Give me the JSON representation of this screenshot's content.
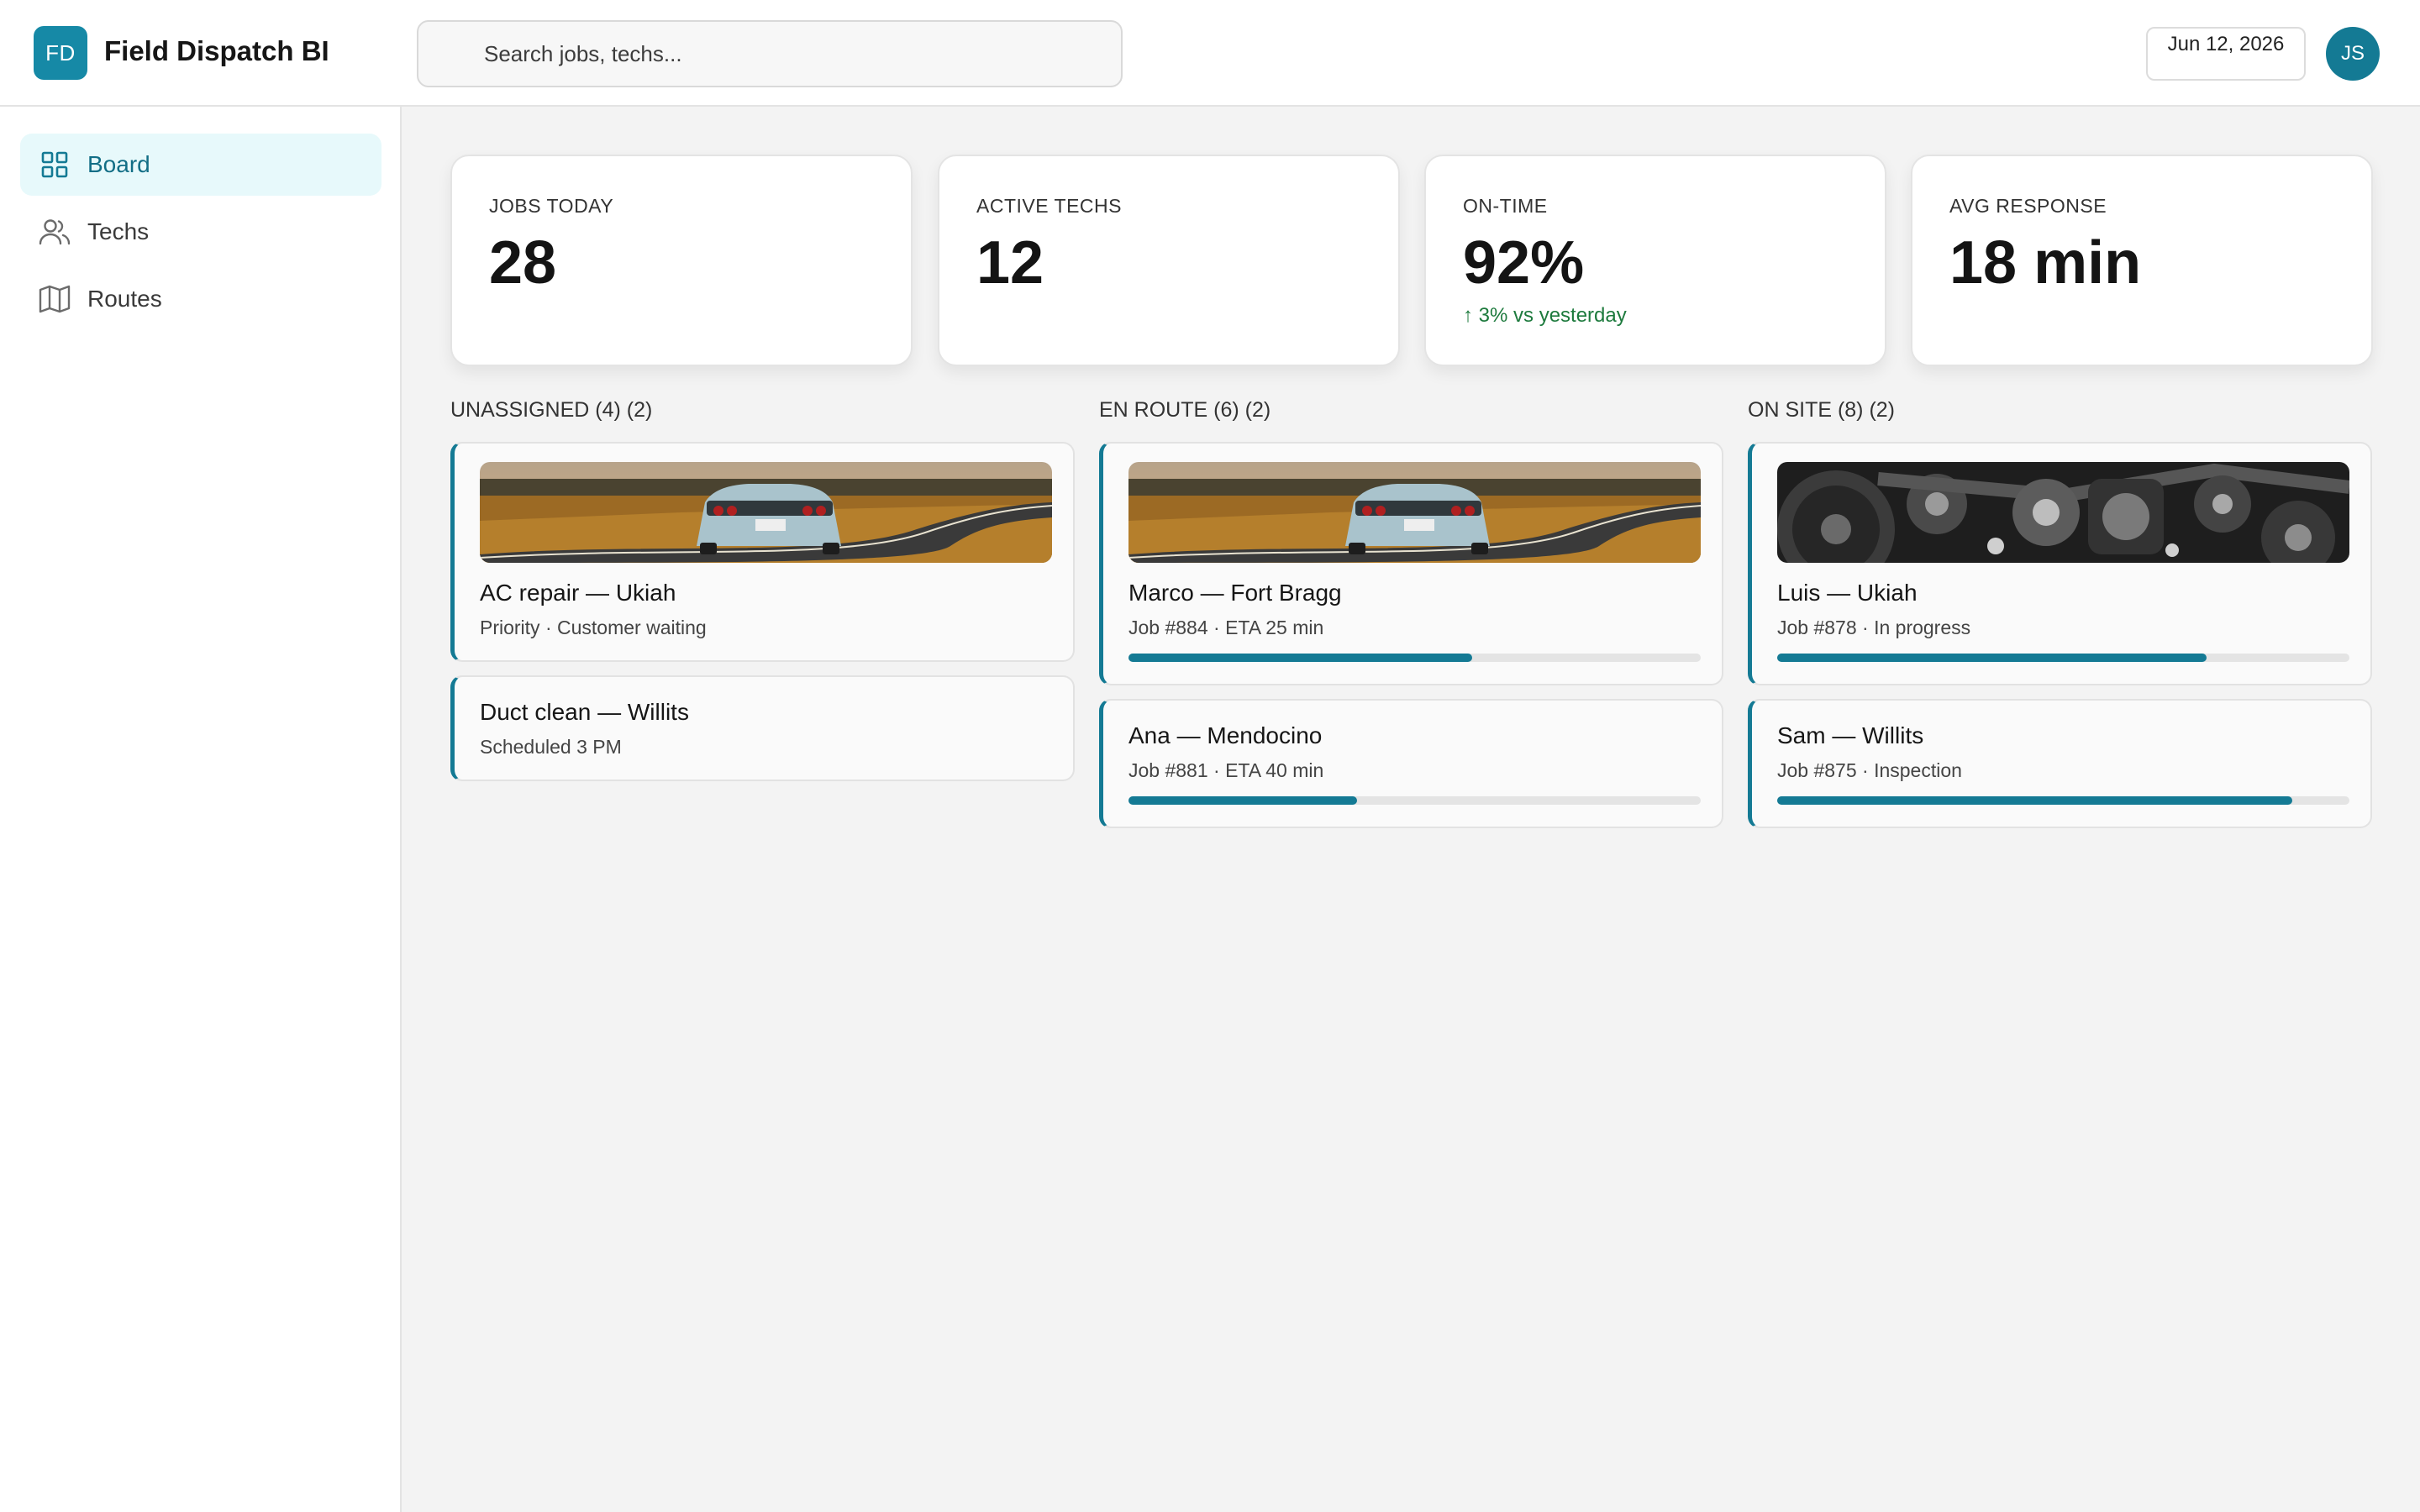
{
  "app": {
    "logo_text": "FD",
    "title": "Field Dispatch BI"
  },
  "header": {
    "search_placeholder": "Search jobs, techs...",
    "date": "Jun 12, 2026",
    "avatar_initials": "JS"
  },
  "sidebar": {
    "items": [
      {
        "label": "Board",
        "icon": "grid-icon",
        "active": true
      },
      {
        "label": "Techs",
        "icon": "users-icon",
        "active": false
      },
      {
        "label": "Routes",
        "icon": "map-icon",
        "active": false
      }
    ]
  },
  "kpis": [
    {
      "label": "JOBS TODAY",
      "value": "28"
    },
    {
      "label": "ACTIVE TECHS",
      "value": "12"
    },
    {
      "label": "ON-TIME",
      "value": "92%",
      "trend": "↑ 3% vs yesterday"
    },
    {
      "label": "AVG RESPONSE",
      "value": "18 min"
    }
  ],
  "columns": [
    {
      "title": "UNASSIGNED (4) (2)",
      "cards": [
        {
          "title": "AC repair — Ukiah",
          "subtitle": "Priority · Customer waiting",
          "image": "road-car-image"
        },
        {
          "title": "Duct clean — Willits",
          "subtitle": "Scheduled 3 PM"
        }
      ]
    },
    {
      "title": "EN ROUTE (6) (2)",
      "cards": [
        {
          "title": "Marco — Fort Bragg",
          "subtitle": "Job #884 · ETA 25 min",
          "image": "road-car-image",
          "progress": 0.6
        },
        {
          "title": "Ana — Mendocino",
          "subtitle": "Job #881 · ETA 40 min",
          "progress": 0.4
        }
      ]
    },
    {
      "title": "ON SITE (8) (2)",
      "cards": [
        {
          "title": "Luis — Ukiah",
          "subtitle": "Job #878 · In progress",
          "image": "engine-image",
          "progress": 0.75
        },
        {
          "title": "Sam — Willits",
          "subtitle": "Job #875 · Inspection",
          "progress": 0.9
        }
      ]
    }
  ],
  "colors": {
    "accent": "#147a94",
    "trend_positive": "#1d7a3d",
    "nav_active_bg": "#e7f9fb"
  }
}
